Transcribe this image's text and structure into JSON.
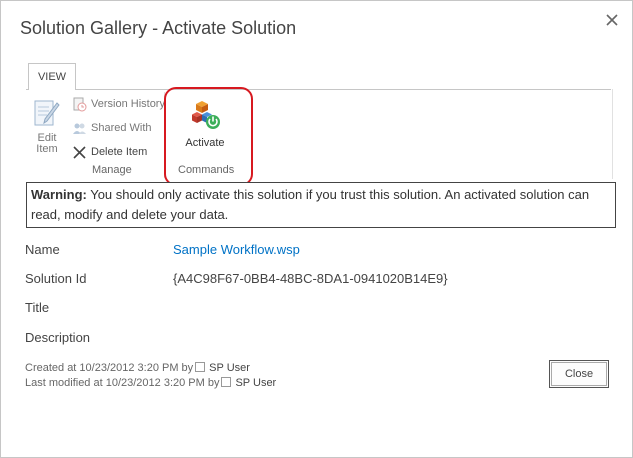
{
  "dialog": {
    "title": "Solution Gallery - Activate Solution"
  },
  "ribbon": {
    "tab_label": "VIEW",
    "manage": {
      "edit_item_line1": "Edit",
      "edit_item_line2": "Item",
      "version_history": "Version History",
      "shared_with": "Shared With",
      "delete_item": "Delete Item",
      "group_label": "Manage"
    },
    "commands": {
      "activate": "Activate",
      "group_label": "Commands"
    }
  },
  "warning": {
    "prefix": "Warning:",
    "text": " You should only activate this solution if you trust this solution. An activated solution can read, modify and delete your data."
  },
  "fields": {
    "name_label": "Name",
    "name_value": "Sample Workflow.wsp",
    "solution_id_label": "Solution Id",
    "solution_id_value": "{A4C98F67-0BB4-48BC-8DA1-0941020B14E9}",
    "title_label": "Title",
    "description_label": "Description"
  },
  "footer": {
    "created": "Created at 10/23/2012 3:20 PM  by",
    "created_user": "SP User",
    "modified": "Last modified at 10/23/2012 3:20 PM  by",
    "modified_user": "SP User",
    "close_label": "Close"
  },
  "colors": {
    "link": "#0072c6",
    "highlight": "#d71920"
  }
}
